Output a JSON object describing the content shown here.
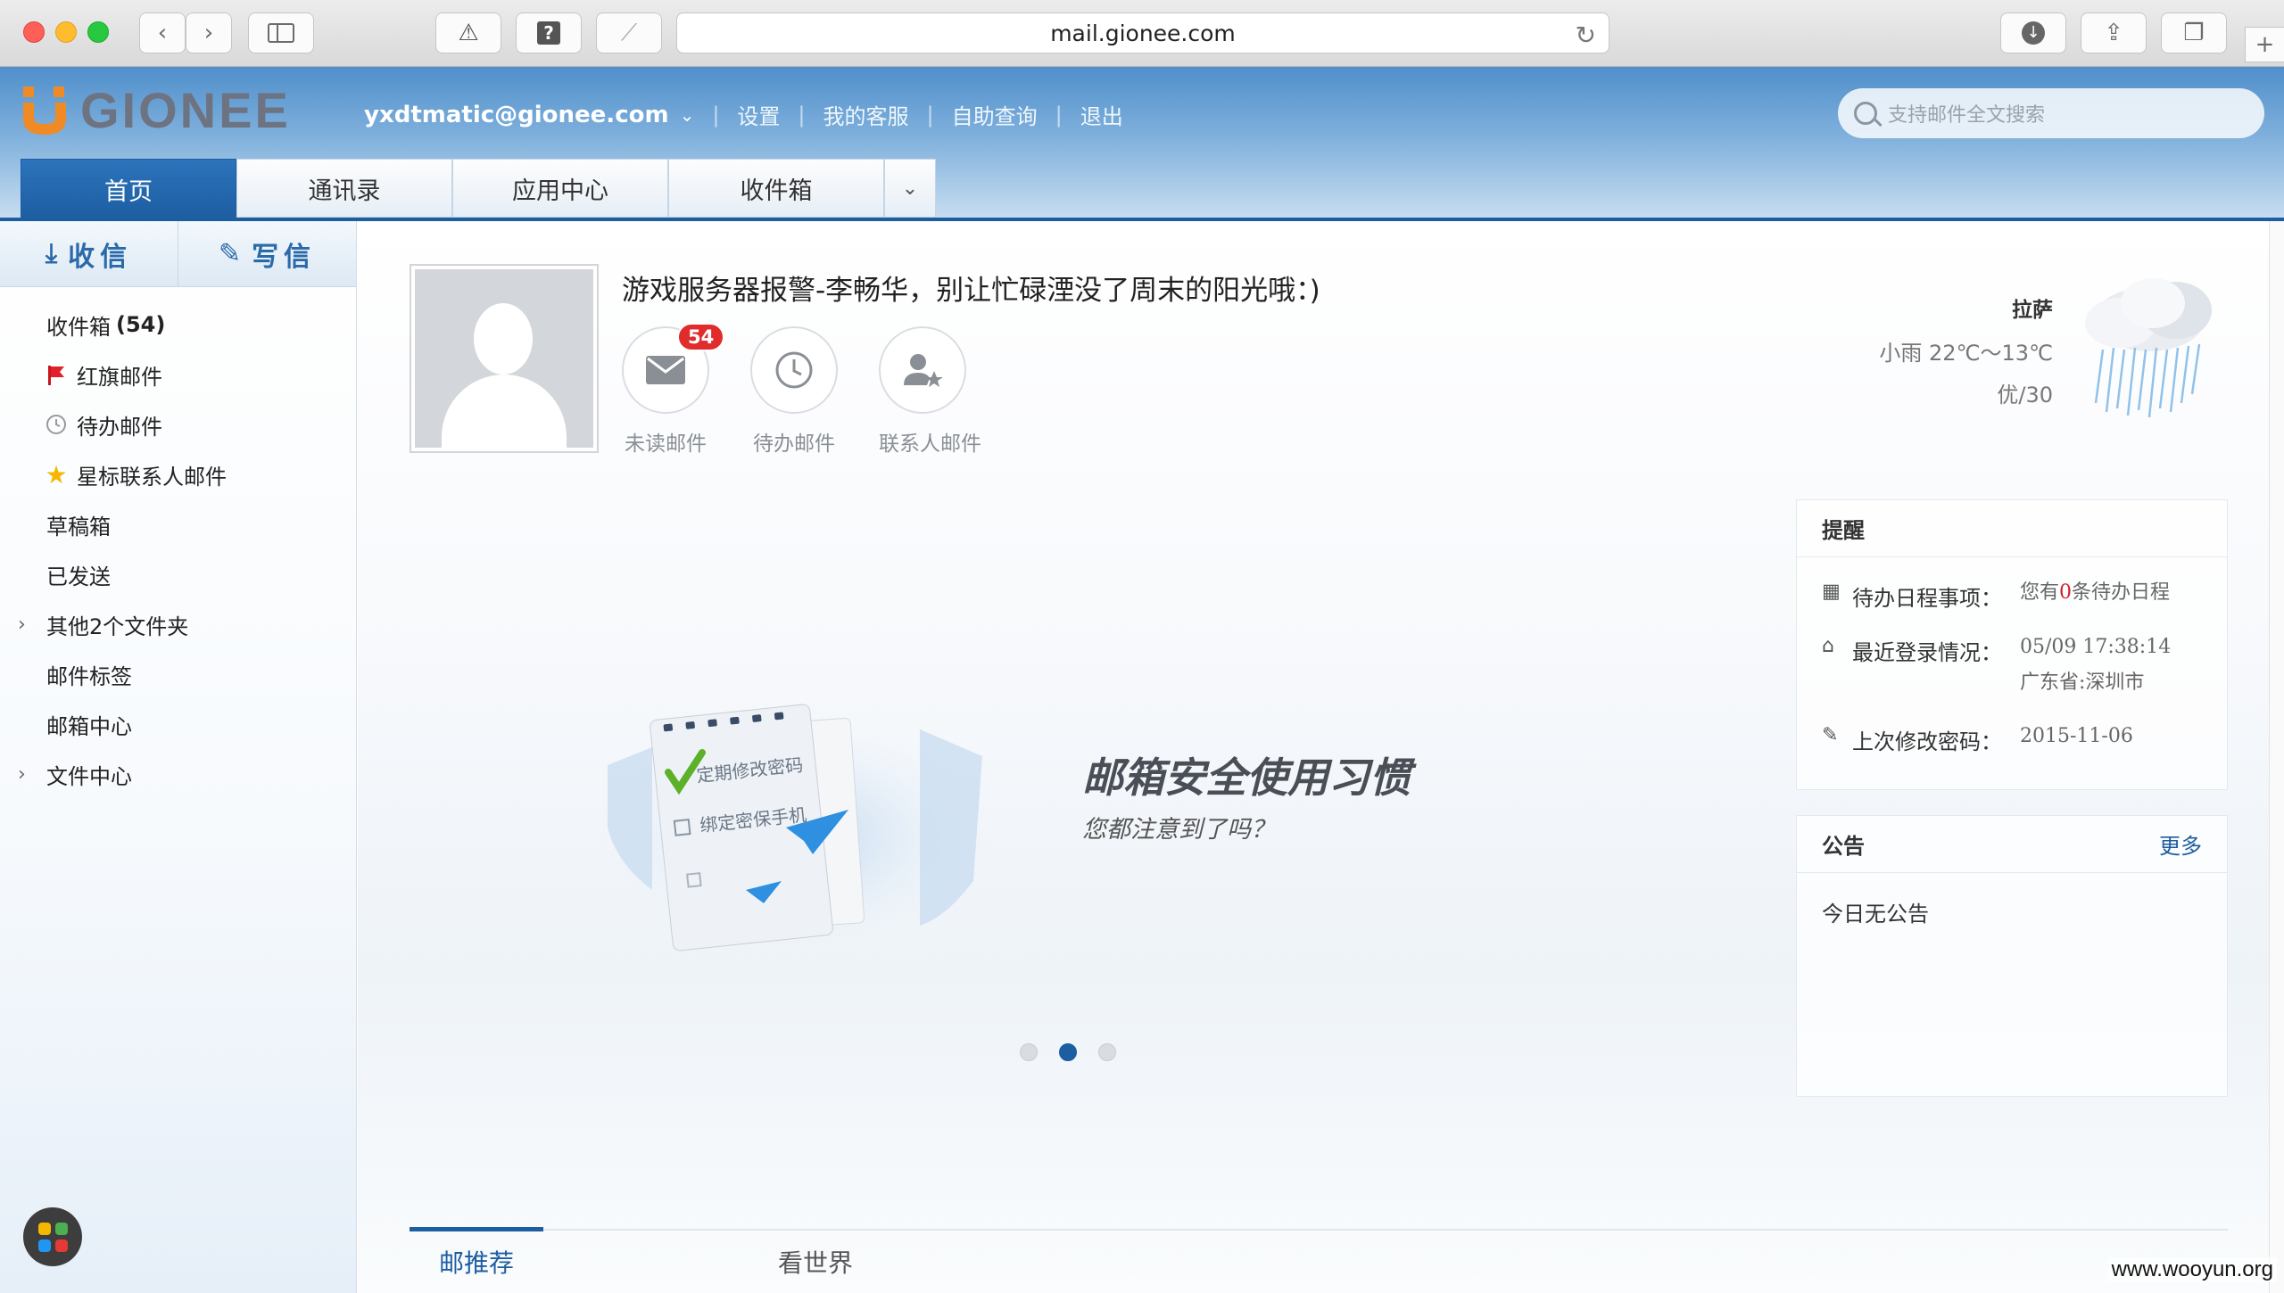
{
  "browser": {
    "url": "mail.gionee.com"
  },
  "header": {
    "logo_text": "GIONEE",
    "user_email": "yxdtmatic@gionee.com",
    "links": [
      "设置",
      "我的客服",
      "自助查询",
      "退出"
    ],
    "search_placeholder": "支持邮件全文搜索",
    "tabs": [
      "首页",
      "通讯录",
      "应用中心",
      "收件箱"
    ]
  },
  "sidebar": {
    "receive_label": "收信",
    "compose_label": "写信",
    "inbox": {
      "label": "收件箱",
      "count": "(54)"
    },
    "folders": [
      {
        "label": "红旗邮件",
        "icon": "red-flag-icon"
      },
      {
        "label": "待办邮件",
        "icon": "clock-icon"
      },
      {
        "label": "星标联系人邮件",
        "icon": "star-icon"
      },
      {
        "label": "草稿箱"
      },
      {
        "label": "已发送"
      },
      {
        "label": "其他2个文件夹",
        "expandable": true
      },
      {
        "label": "邮件标签"
      },
      {
        "label": "邮箱中心"
      },
      {
        "label": "文件中心",
        "expandable": true
      }
    ]
  },
  "main": {
    "greeting": "游戏服务器报警-李畅华，别让忙碌湮没了周末的阳光哦：)",
    "shortcuts": [
      {
        "label": "未读邮件",
        "badge": "54",
        "icon": "envelope-icon"
      },
      {
        "label": "待办邮件",
        "icon": "clock-icon"
      },
      {
        "label": "联系人邮件",
        "icon": "contact-star-icon"
      }
    ],
    "weather": {
      "city": "拉萨",
      "condition": "小雨 22℃～13℃",
      "aqi": "优/30"
    },
    "banner": {
      "title": "邮箱安全使用习惯",
      "subtitle": "您都注意到了吗？",
      "illus_line1": "定期修改密码",
      "illus_line2": "绑定密保手机",
      "active_slide": 2,
      "slide_count": 3
    },
    "reminder": {
      "title": "提醒",
      "schedule_label": "待办日程事项：",
      "schedule_prefix": "您有",
      "schedule_count": "0",
      "schedule_suffix": "条待办日程",
      "login_label": "最近登录情况：",
      "login_time": "05/09 17:38:14",
      "login_location": "广东省:深圳市",
      "pwd_label": "上次修改密码：",
      "pwd_date": "2015-11-06"
    },
    "announcement": {
      "title": "公告",
      "more": "更多",
      "body": "今日无公告"
    },
    "bottom_tabs": [
      "邮推荐",
      "看世界"
    ]
  },
  "watermark": "www.wooyun.org",
  "colors": {
    "brand_blue": "#1d5da1",
    "logo_orange": "#f08a24",
    "badge_red": "#e02c2c"
  }
}
